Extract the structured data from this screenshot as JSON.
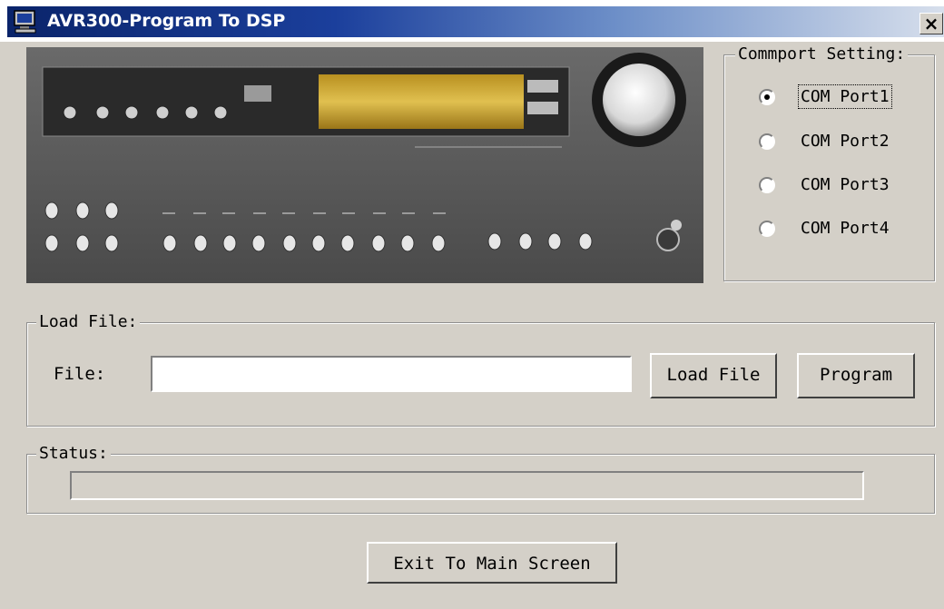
{
  "window": {
    "title": "AVR300-Program To DSP",
    "close_label": "×"
  },
  "commport": {
    "legend": "Commport Setting:",
    "options": [
      {
        "label": "COM Port1",
        "selected": true
      },
      {
        "label": "COM Port2",
        "selected": false
      },
      {
        "label": "COM Port3",
        "selected": false
      },
      {
        "label": "COM Port4",
        "selected": false
      }
    ]
  },
  "load_file": {
    "legend": "Load File:",
    "file_label": "File:",
    "file_value": "",
    "load_button": "Load File",
    "program_button": "Program"
  },
  "status": {
    "legend": "Status:",
    "progress": 0
  },
  "exit_button": "Exit To Main Screen",
  "colors": {
    "title_gradient_start": "#0a246a",
    "title_gradient_end": "#d7dfec",
    "window_face": "#d4d0c8",
    "display_amber": "#c9a52a"
  },
  "icons": {
    "title_icon": "computer-icon",
    "close_icon": "close-icon"
  }
}
